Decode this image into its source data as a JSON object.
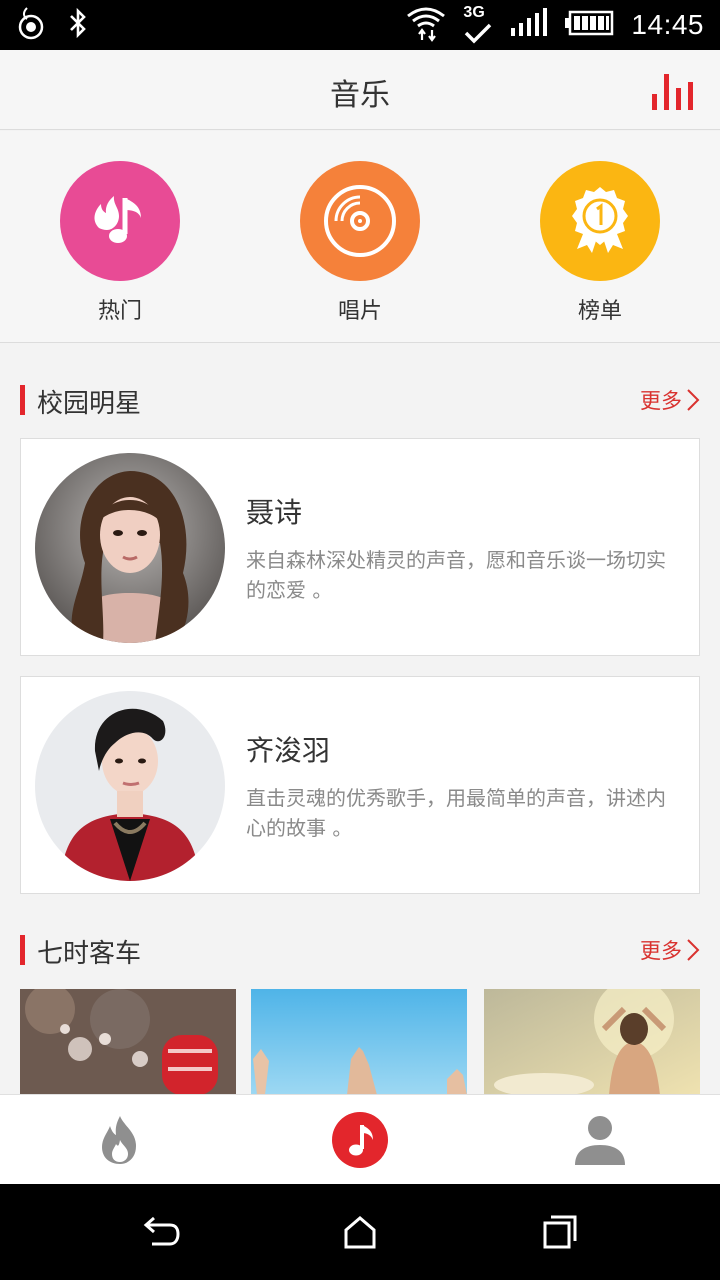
{
  "status": {
    "time": "14:45",
    "network": "3G"
  },
  "header": {
    "title": "音乐"
  },
  "categories": [
    {
      "label": "热门",
      "icon": "music-fire-icon",
      "color": "#e84b95"
    },
    {
      "label": "唱片",
      "icon": "vinyl-disc-icon",
      "color": "#f5813a"
    },
    {
      "label": "榜单",
      "icon": "award-badge-icon",
      "color": "#fbb612"
    }
  ],
  "sections": {
    "campus": {
      "title": "校园明星",
      "more": "更多"
    },
    "seven": {
      "title": "七时客车",
      "more": "更多"
    }
  },
  "artists": [
    {
      "name": "聂诗",
      "desc": "来自森林深处精灵的声音，愿和音乐谈一场切实的恋爱 。"
    },
    {
      "name": "齐浚羽",
      "desc": "直击灵魂的优秀歌手，用最简单的声音，讲述内心的故事 。"
    }
  ],
  "tabs": [
    {
      "icon": "flame-icon"
    },
    {
      "icon": "music-note-icon"
    },
    {
      "icon": "user-icon"
    }
  ],
  "colors": {
    "accent": "#e3262c",
    "more": "#d9322f"
  }
}
